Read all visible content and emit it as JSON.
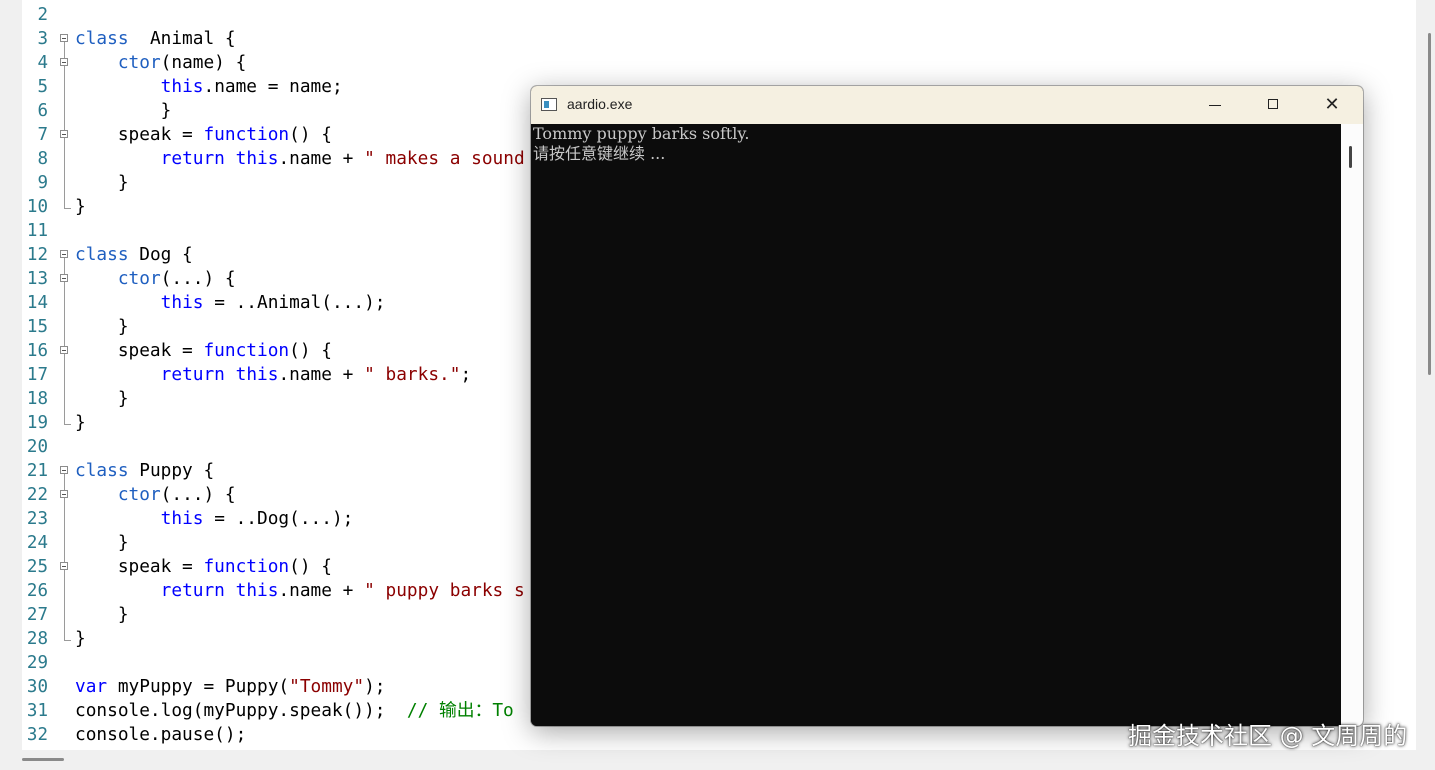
{
  "editor": {
    "first_line_number": 2,
    "lines": [
      {
        "n": "2",
        "parts": []
      },
      {
        "n": "3",
        "parts": [
          [
            "kw2",
            "class"
          ],
          [
            "",
            "  Animal {"
          ]
        ]
      },
      {
        "n": "4",
        "parts": [
          [
            "",
            "    "
          ],
          [
            "kw2",
            "ctor"
          ],
          [
            "",
            "(name) {"
          ]
        ]
      },
      {
        "n": "5",
        "parts": [
          [
            "",
            "        "
          ],
          [
            "kw",
            "this"
          ],
          [
            "",
            ".name = name;"
          ]
        ]
      },
      {
        "n": "6",
        "parts": [
          [
            "",
            "        }"
          ]
        ]
      },
      {
        "n": "7",
        "parts": [
          [
            "",
            "    speak = "
          ],
          [
            "kw",
            "function"
          ],
          [
            "",
            "() {"
          ]
        ]
      },
      {
        "n": "8",
        "parts": [
          [
            "",
            "        "
          ],
          [
            "kw",
            "return"
          ],
          [
            "",
            " "
          ],
          [
            "kw",
            "this"
          ],
          [
            "",
            ".name + "
          ],
          [
            "str",
            "\" makes a sound"
          ]
        ]
      },
      {
        "n": "9",
        "parts": [
          [
            "",
            "    }"
          ]
        ]
      },
      {
        "n": "10",
        "parts": [
          [
            "",
            "}"
          ]
        ]
      },
      {
        "n": "11",
        "parts": []
      },
      {
        "n": "12",
        "parts": [
          [
            "kw2",
            "class"
          ],
          [
            "",
            " Dog {"
          ]
        ]
      },
      {
        "n": "13",
        "parts": [
          [
            "",
            "    "
          ],
          [
            "kw2",
            "ctor"
          ],
          [
            "",
            "(...) {"
          ]
        ]
      },
      {
        "n": "14",
        "parts": [
          [
            "",
            "        "
          ],
          [
            "kw",
            "this"
          ],
          [
            "",
            " = ..Animal(...);"
          ]
        ]
      },
      {
        "n": "15",
        "parts": [
          [
            "",
            "    }"
          ]
        ]
      },
      {
        "n": "16",
        "parts": [
          [
            "",
            "    speak = "
          ],
          [
            "kw",
            "function"
          ],
          [
            "",
            "() {"
          ]
        ]
      },
      {
        "n": "17",
        "parts": [
          [
            "",
            "        "
          ],
          [
            "kw",
            "return"
          ],
          [
            "",
            " "
          ],
          [
            "kw",
            "this"
          ],
          [
            "",
            ".name + "
          ],
          [
            "str",
            "\" barks.\""
          ],
          [
            "",
            ";"
          ]
        ]
      },
      {
        "n": "18",
        "parts": [
          [
            "",
            "    }"
          ]
        ]
      },
      {
        "n": "19",
        "parts": [
          [
            "",
            "}"
          ]
        ]
      },
      {
        "n": "20",
        "parts": []
      },
      {
        "n": "21",
        "parts": [
          [
            "kw2",
            "class"
          ],
          [
            "",
            " Puppy {"
          ]
        ]
      },
      {
        "n": "22",
        "parts": [
          [
            "",
            "    "
          ],
          [
            "kw2",
            "ctor"
          ],
          [
            "",
            "(...) {"
          ]
        ]
      },
      {
        "n": "23",
        "parts": [
          [
            "",
            "        "
          ],
          [
            "kw",
            "this"
          ],
          [
            "",
            " = ..Dog(...);"
          ]
        ]
      },
      {
        "n": "24",
        "parts": [
          [
            "",
            "    }"
          ]
        ]
      },
      {
        "n": "25",
        "parts": [
          [
            "",
            "    speak = "
          ],
          [
            "kw",
            "function"
          ],
          [
            "",
            "() {"
          ]
        ]
      },
      {
        "n": "26",
        "parts": [
          [
            "",
            "        "
          ],
          [
            "kw",
            "return"
          ],
          [
            "",
            " "
          ],
          [
            "kw",
            "this"
          ],
          [
            "",
            ".name + "
          ],
          [
            "str",
            "\" puppy barks s"
          ]
        ]
      },
      {
        "n": "27",
        "parts": [
          [
            "",
            "    }"
          ]
        ]
      },
      {
        "n": "28",
        "parts": [
          [
            "",
            "}"
          ]
        ]
      },
      {
        "n": "29",
        "parts": []
      },
      {
        "n": "30",
        "parts": [
          [
            "kw",
            "var"
          ],
          [
            "",
            " myPuppy = Puppy("
          ],
          [
            "str",
            "\"Tommy\""
          ],
          [
            "",
            ");"
          ]
        ]
      },
      {
        "n": "31",
        "parts": [
          [
            "",
            "console.log(myPuppy.speak());  "
          ],
          [
            "cmt",
            "// 输出：To"
          ]
        ]
      },
      {
        "n": "32",
        "parts": [
          [
            "",
            "console.pause();"
          ]
        ]
      }
    ]
  },
  "console_window": {
    "title": "aardio.exe",
    "minimize_label": "",
    "maximize_label": "",
    "close_label": "✕",
    "output_lines": [
      "Tommy puppy barks softly.",
      "请按任意键继续 ..."
    ]
  },
  "watermark": "掘金技术社区 @ 文周周的"
}
